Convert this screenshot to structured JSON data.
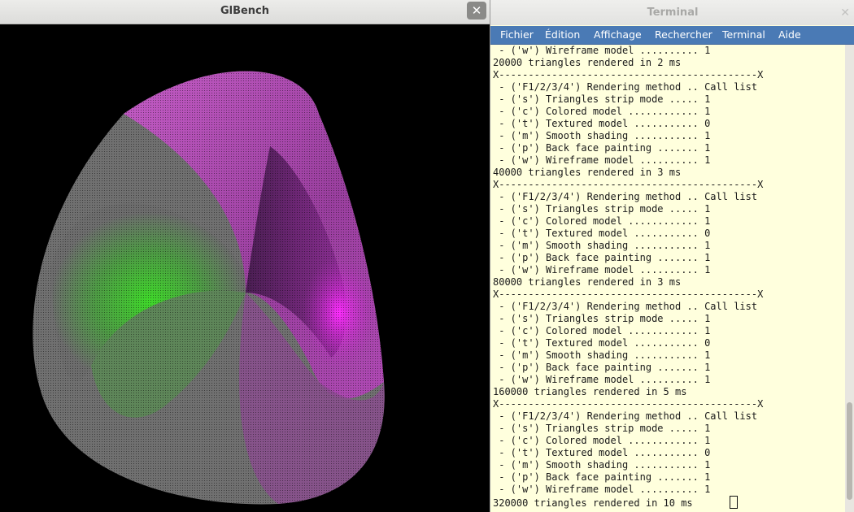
{
  "glbench": {
    "title": "GlBench",
    "close_glyph": "✕"
  },
  "terminal": {
    "title": "Terminal",
    "close_glyph": "✕",
    "menu": [
      "Fichier",
      "Édition",
      "Affichage",
      "Rechercher",
      "Terminal",
      "Aide"
    ],
    "lines": [
      " - ('w') Wireframe model .......... 1",
      "20000 triangles rendered in 2 ms",
      "X--------------------------------------------X",
      " - ('F1/2/3/4') Rendering method .. Call list",
      " - ('s') Triangles strip mode ..... 1",
      " - ('c') Colored model ............ 1",
      " - ('t') Textured model ........... 0",
      " - ('m') Smooth shading ........... 1",
      " - ('p') Back face painting ....... 1",
      " - ('w') Wireframe model .......... 1",
      "40000 triangles rendered in 3 ms",
      "X--------------------------------------------X",
      " - ('F1/2/3/4') Rendering method .. Call list",
      " - ('s') Triangles strip mode ..... 1",
      " - ('c') Colored model ............ 1",
      " - ('t') Textured model ........... 0",
      " - ('m') Smooth shading ........... 1",
      " - ('p') Back face painting ....... 1",
      " - ('w') Wireframe model .......... 1",
      "80000 triangles rendered in 3 ms",
      "X--------------------------------------------X",
      " - ('F1/2/3/4') Rendering method .. Call list",
      " - ('s') Triangles strip mode ..... 1",
      " - ('c') Colored model ............ 1",
      " - ('t') Textured model ........... 0",
      " - ('m') Smooth shading ........... 1",
      " - ('p') Back face painting ....... 1",
      " - ('w') Wireframe model .......... 1",
      "160000 triangles rendered in 5 ms",
      "X--------------------------------------------X",
      " - ('F1/2/3/4') Rendering method .. Call list",
      " - ('s') Triangles strip mode ..... 1",
      " - ('c') Colored model ............ 1",
      " - ('t') Textured model ........... 0",
      " - ('m') Smooth shading ........... 1",
      " - ('p') Back face painting ....... 1",
      " - ('w') Wireframe model .......... 1",
      "320000 triangles rendered in 10 ms"
    ]
  }
}
